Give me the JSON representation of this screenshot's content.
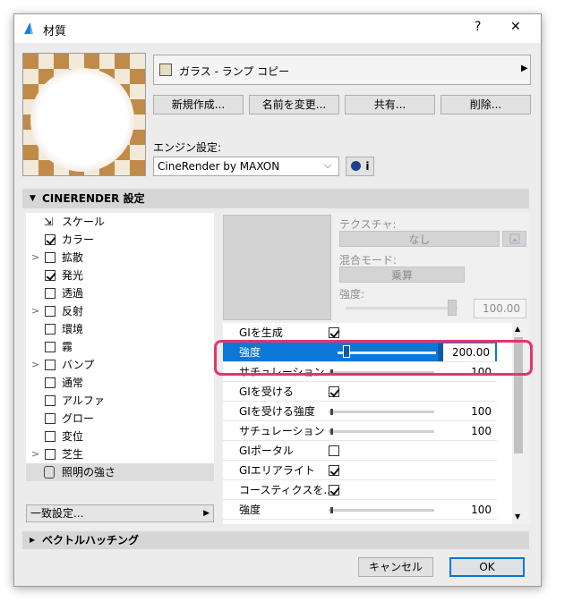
{
  "window": {
    "title": "材質",
    "help": "?",
    "close": "✕"
  },
  "material": {
    "name": "ガラス - ランプ コピー"
  },
  "buttons": {
    "new": "新規作成...",
    "rename": "名前を変更...",
    "share": "共有...",
    "delete": "削除..."
  },
  "engine": {
    "label": "エンジン設定:",
    "value": "CineRender by MAXON",
    "info": "i"
  },
  "section": {
    "cinerender": "CINERENDER 設定",
    "vector": "ベクトルハッチング"
  },
  "tree": [
    {
      "label": "スケール",
      "checkbox": null,
      "expand": false,
      "icon": "scale-icon"
    },
    {
      "label": "カラー",
      "checkbox": true,
      "expand": false
    },
    {
      "label": "拡散",
      "checkbox": false,
      "expand": true
    },
    {
      "label": "発光",
      "checkbox": true,
      "expand": false
    },
    {
      "label": "透過",
      "checkbox": false,
      "expand": false
    },
    {
      "label": "反射",
      "checkbox": false,
      "expand": true
    },
    {
      "label": "環境",
      "checkbox": false,
      "expand": false
    },
    {
      "label": "霧",
      "checkbox": false,
      "expand": false
    },
    {
      "label": "バンプ",
      "checkbox": false,
      "expand": true
    },
    {
      "label": "通常",
      "checkbox": false,
      "expand": false
    },
    {
      "label": "アルファ",
      "checkbox": false,
      "expand": false
    },
    {
      "label": "グロー",
      "checkbox": false,
      "expand": false
    },
    {
      "label": "変位",
      "checkbox": false,
      "expand": false
    },
    {
      "label": "芝生",
      "checkbox": false,
      "expand": true
    },
    {
      "label": "照明の強さ",
      "checkbox": null,
      "expand": false,
      "icon": "lock-icon",
      "selected": true
    }
  ],
  "match_settings": "一致設定...",
  "texture": {
    "label": "テクスチャ:",
    "value": "なし",
    "blend_label": "混合モード:",
    "blend_value": "乗算",
    "strength_label": "強度:",
    "strength_value": "100.00",
    "strength_level": 1.0
  },
  "props": [
    {
      "label": "GIを生成",
      "type": "check",
      "checked": true
    },
    {
      "label": "強度",
      "type": "slider",
      "value": "200.00",
      "level": 0.05,
      "selected": true
    },
    {
      "label": "サチュレーション",
      "type": "slider",
      "value": "100",
      "level": 0.02
    },
    {
      "label": "GIを受ける",
      "type": "check",
      "checked": true
    },
    {
      "label": "GIを受ける強度",
      "type": "slider",
      "value": "100",
      "level": 0.02
    },
    {
      "label": "サチュレーション",
      "type": "slider",
      "value": "100",
      "level": 0.02
    },
    {
      "label": "GIポータル",
      "type": "check",
      "checked": false
    },
    {
      "label": "GIエリアライト",
      "type": "check",
      "checked": true
    },
    {
      "label": "コースティクスを...",
      "type": "check",
      "checked": true
    },
    {
      "label": "強度",
      "type": "slider",
      "value": "100",
      "level": 0.02
    }
  ],
  "footer": {
    "cancel": "キャンセル",
    "ok": "OK"
  },
  "colors": {
    "accent": "#0078d7",
    "highlight": "#e8336d",
    "selected_row": "#0b78d8"
  }
}
